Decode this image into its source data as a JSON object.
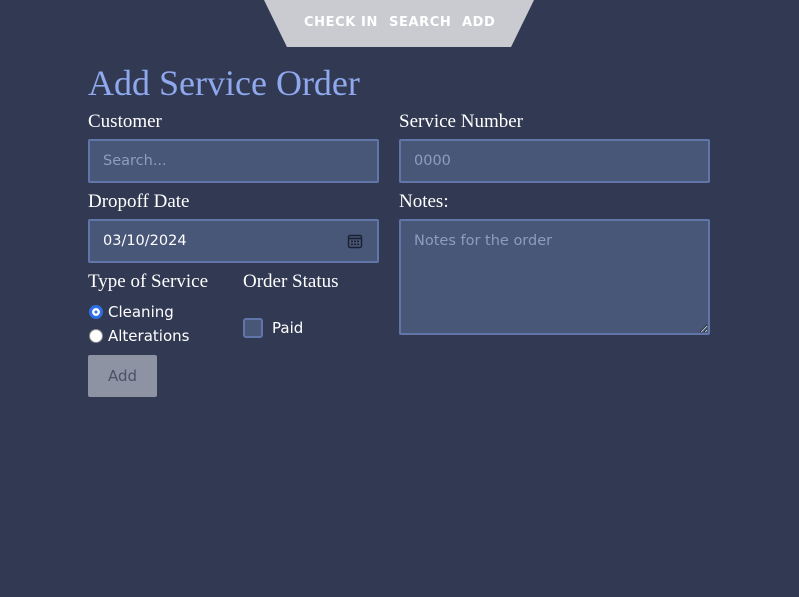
{
  "nav": {
    "items": [
      "CHECK IN",
      "SEARCH",
      "ADD"
    ]
  },
  "page": {
    "title": "Add Service Order"
  },
  "form": {
    "customer": {
      "label": "Customer",
      "placeholder": "Search..."
    },
    "service_number": {
      "label": "Service Number",
      "placeholder": "0000"
    },
    "dropoff_date": {
      "label": "Dropoff Date",
      "value": "03/10/2024",
      "icon": "calendar-icon"
    },
    "notes": {
      "label": "Notes:",
      "placeholder": "Notes for the order"
    },
    "service_type": {
      "label": "Type of Service",
      "options": [
        {
          "label": "Cleaning",
          "selected": true
        },
        {
          "label": "Alterations",
          "selected": false
        }
      ]
    },
    "order_status": {
      "label": "Order Status",
      "paid": {
        "label": "Paid",
        "checked": false
      }
    },
    "submit_label": "Add"
  },
  "colors": {
    "background": "#323a53",
    "title": "#8fa8ee",
    "field_bg": "#485677",
    "field_border": "#6275a8",
    "nav_bg": "#c9cbd1",
    "radio_selected": "#2f6fe6",
    "button_bg": "#8d93a3"
  }
}
